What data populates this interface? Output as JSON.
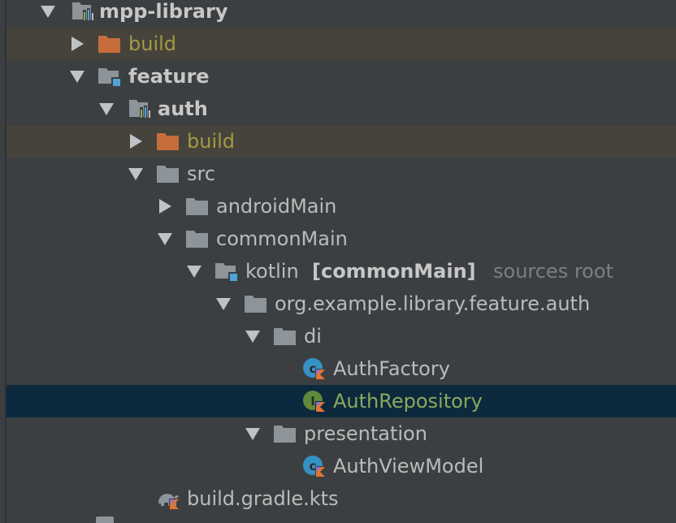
{
  "project_tree": {
    "rows": [
      {
        "label": "mpp-library",
        "icon": "module-folder-icon"
      },
      {
        "label": "build",
        "icon": "excluded-folder-icon"
      },
      {
        "label": "feature",
        "icon": "source-folder-icon"
      },
      {
        "label": "auth",
        "icon": "module-folder-icon"
      },
      {
        "label": "build",
        "icon": "excluded-folder-icon"
      },
      {
        "label": "src",
        "icon": "folder-icon"
      },
      {
        "label": "androidMain",
        "icon": "folder-icon"
      },
      {
        "label": "commonMain",
        "icon": "folder-icon"
      },
      {
        "label": "kotlin",
        "qualifier": "[commonMain]",
        "suffix": "sources root",
        "icon": "source-root-folder-icon"
      },
      {
        "label": "org.example.library.feature.auth",
        "icon": "package-folder-icon"
      },
      {
        "label": "di",
        "icon": "package-folder-icon"
      },
      {
        "label": "AuthFactory",
        "icon": "kotlin-class-icon"
      },
      {
        "label": "AuthRepository",
        "icon": "kotlin-interface-icon"
      },
      {
        "label": "presentation",
        "icon": "package-folder-icon"
      },
      {
        "label": "AuthViewModel",
        "icon": "kotlin-class-icon"
      },
      {
        "label": "build.gradle.kts",
        "icon": "gradle-file-icon"
      }
    ]
  },
  "colors": {
    "background": "#3c3f41",
    "excluded_row": "#45433b",
    "selected_row": "#0d293e",
    "excluded_text": "#a39a44",
    "modified_text": "#8aa95c",
    "excluded_folder": "#c76d3c",
    "folder": "#8d949a",
    "source_marker": "#4fa3d8"
  }
}
